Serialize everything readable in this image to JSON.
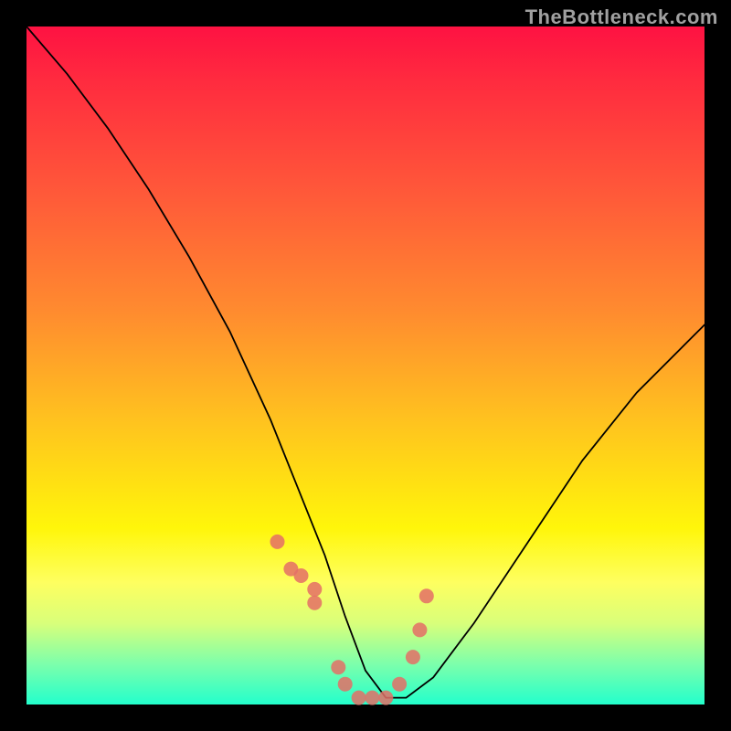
{
  "watermark": "TheBottleneck.com",
  "chart_data": {
    "type": "line",
    "title": "",
    "xlabel": "",
    "ylabel": "",
    "xlim": [
      0,
      100
    ],
    "ylim": [
      0,
      100
    ],
    "series": [
      {
        "name": "curve",
        "x": [
          0,
          6,
          12,
          18,
          24,
          30,
          36,
          40,
          44,
          47,
          50,
          53,
          56,
          60,
          66,
          74,
          82,
          90,
          98,
          100
        ],
        "y": [
          100,
          93,
          85,
          76,
          66,
          55,
          42,
          32,
          22,
          13,
          5,
          1,
          1,
          4,
          12,
          24,
          36,
          46,
          54,
          56
        ]
      },
      {
        "name": "markers",
        "x": [
          37,
          39,
          40.5,
          42.5,
          42.5,
          46,
          47,
          49,
          51,
          53,
          55,
          57,
          58,
          59
        ],
        "y": [
          24,
          20,
          19,
          17,
          15,
          5.5,
          3,
          1,
          1,
          1,
          3,
          7,
          11,
          16
        ]
      }
    ],
    "marker_color": "#e46e66"
  }
}
